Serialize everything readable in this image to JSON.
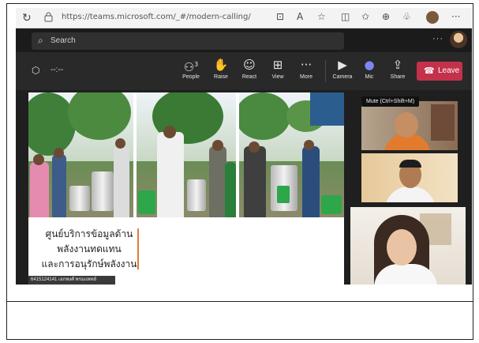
{
  "browser": {
    "url": "https://teams.microsoft.com/_#/modern-calling/",
    "icons": [
      "refresh-icon",
      "lock-icon",
      "camera-blocked-icon",
      "read-aloud-icon",
      "favorite-icon",
      "split-screen-icon",
      "favorites-bar-icon",
      "collections-icon",
      "extensions-icon",
      "profile-icon",
      "more-icon"
    ]
  },
  "teams": {
    "search_placeholder": "Search",
    "more_label": "···"
  },
  "toolbar": {
    "timer": "--:--",
    "people": {
      "label": "People",
      "count": "3"
    },
    "raise": {
      "label": "Raise"
    },
    "react": {
      "label": "React"
    },
    "view": {
      "label": "View"
    },
    "more": {
      "label": "More"
    },
    "camera": {
      "label": "Camera"
    },
    "mic": {
      "label": "Mic"
    },
    "share": {
      "label": "Share"
    },
    "leave": {
      "label": "Leave"
    },
    "mute_tooltip": "Mute (Ctrl+Shift+M)"
  },
  "shared_content": {
    "thai_line1": "ศูนย์บริการข้อมูลด้าน",
    "thai_line2": "พลังงานทดแทน",
    "thai_line3": "และการอนุรักษ์พลังงาน",
    "presenter_tag": "6415124141 เอกพงศ์ พรมแพทย์"
  },
  "colors": {
    "leave": "#c4314b",
    "accent_orange": "#e07b39",
    "teams_bg": "#1f1f1f"
  }
}
